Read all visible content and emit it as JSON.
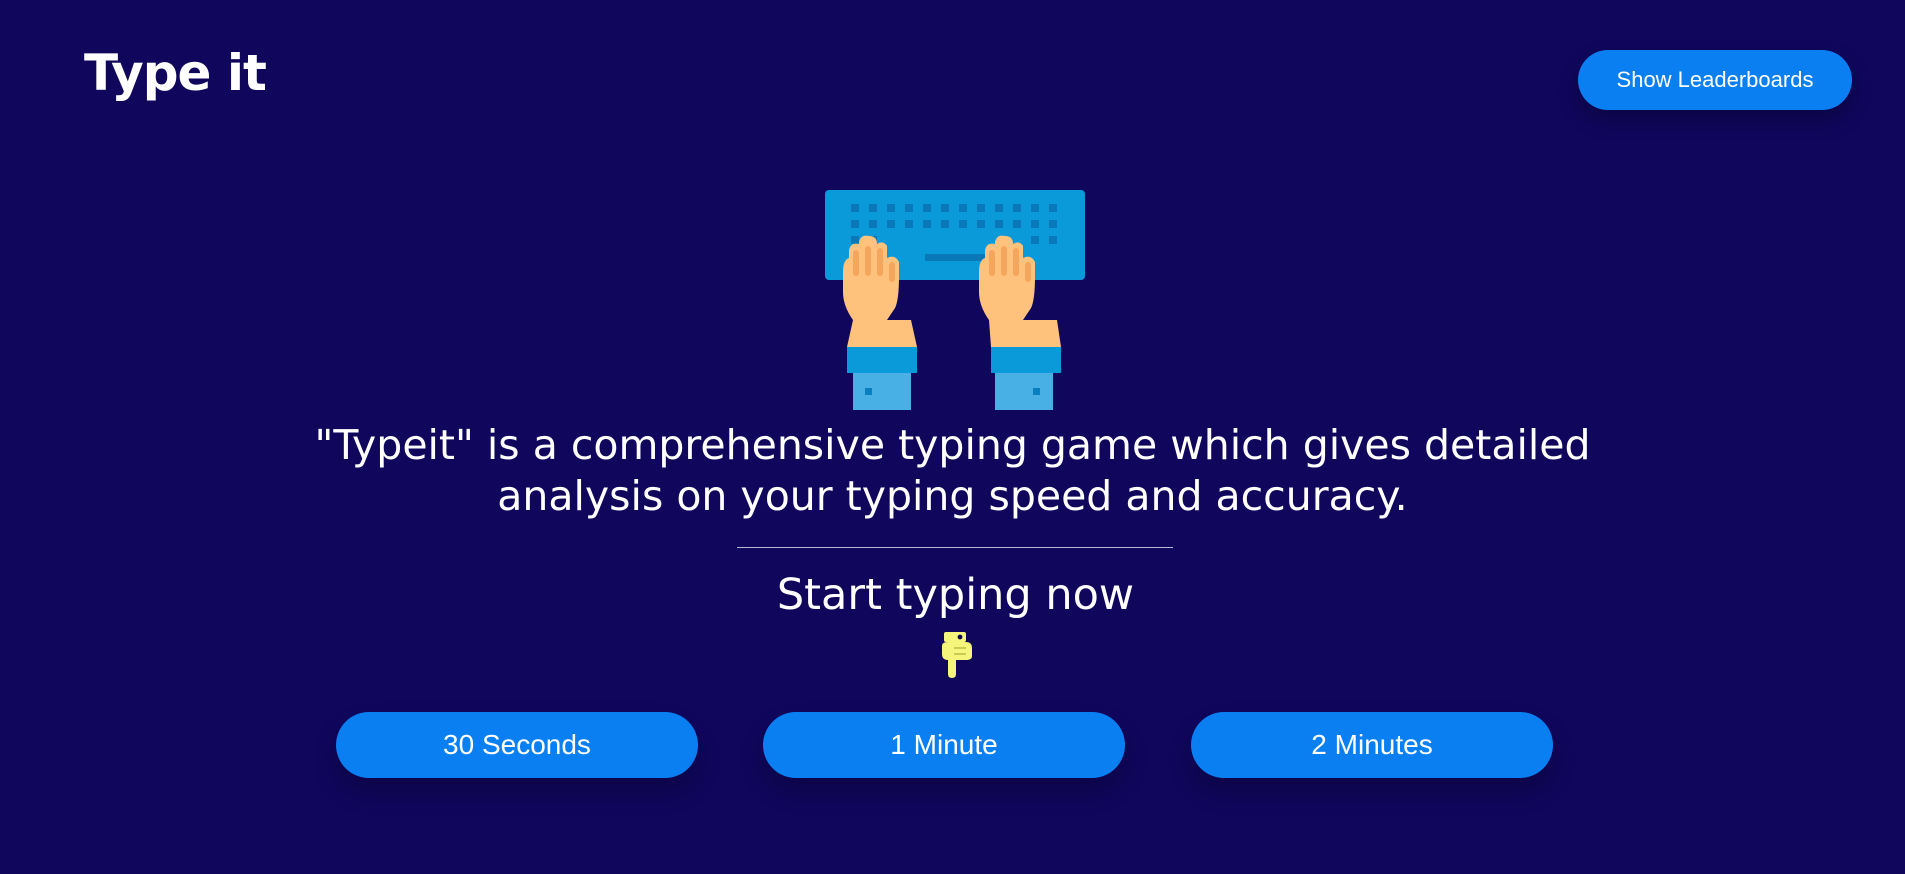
{
  "header": {
    "logo_text": "Type it",
    "leaderboard_label": "Show Leaderboards"
  },
  "hero": {
    "illustration_icon": "hands-typing-keyboard-icon",
    "description": "\"Typeit\" is a comprehensive typing game which gives detailed analysis on your typing speed and accuracy."
  },
  "start": {
    "title": "Start typing now",
    "pointer_icon": "pointing-down-hand-icon"
  },
  "durations": [
    {
      "label": "30 Seconds"
    },
    {
      "label": "1 Minute"
    },
    {
      "label": "2 Minutes"
    }
  ],
  "colors": {
    "background": "#10065c",
    "button": "#0a7ff2",
    "keyboard": "#0a9ad9",
    "skin": "#ffc27d",
    "pointer": "#f4f57a"
  }
}
